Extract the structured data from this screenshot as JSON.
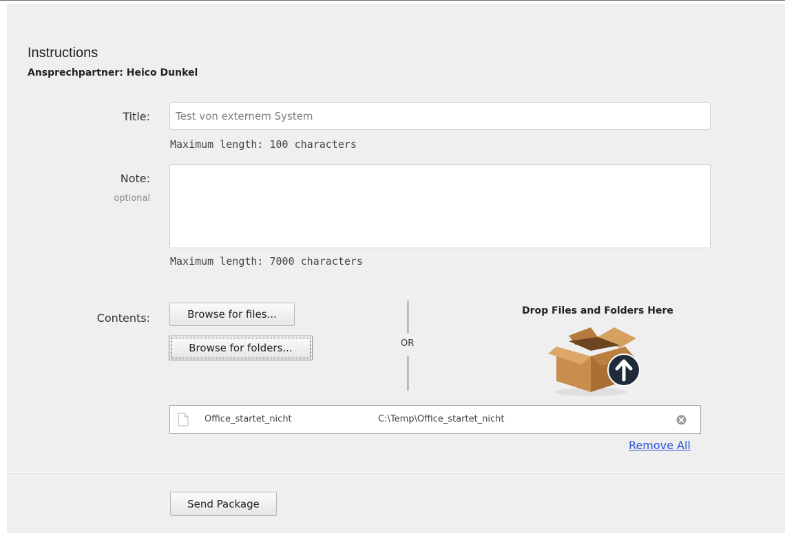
{
  "header": {
    "title": "Instructions",
    "contact": "Ansprechpartner: Heico Dunkel"
  },
  "form": {
    "title_label": "Title:",
    "title_placeholder": "Test von externem System",
    "title_hint": "Maximum length: 100 characters",
    "note_label": "Note:",
    "note_optional": "optional",
    "note_hint": "Maximum length: 7000 characters",
    "contents_label": "Contents:"
  },
  "contents": {
    "browse_files": "Browse for files...",
    "browse_folders": "Browse for folders...",
    "or_text": "OR",
    "drop_title": "Drop Files and Folders Here",
    "files": [
      {
        "name": "Office_startet_nicht",
        "path": "C:\\Temp\\Office_startet_nicht"
      }
    ],
    "remove_all": "Remove All"
  },
  "footer": {
    "send_label": "Send Package"
  },
  "colors": {
    "panel_bg": "#efefef",
    "link": "#2a4fd6",
    "upload_badge": "#1f2a3a",
    "box_brown": "#c98d4d"
  },
  "icons": {
    "file": "file-icon",
    "remove": "remove-circle-icon",
    "drop": "box-upload-icon"
  }
}
